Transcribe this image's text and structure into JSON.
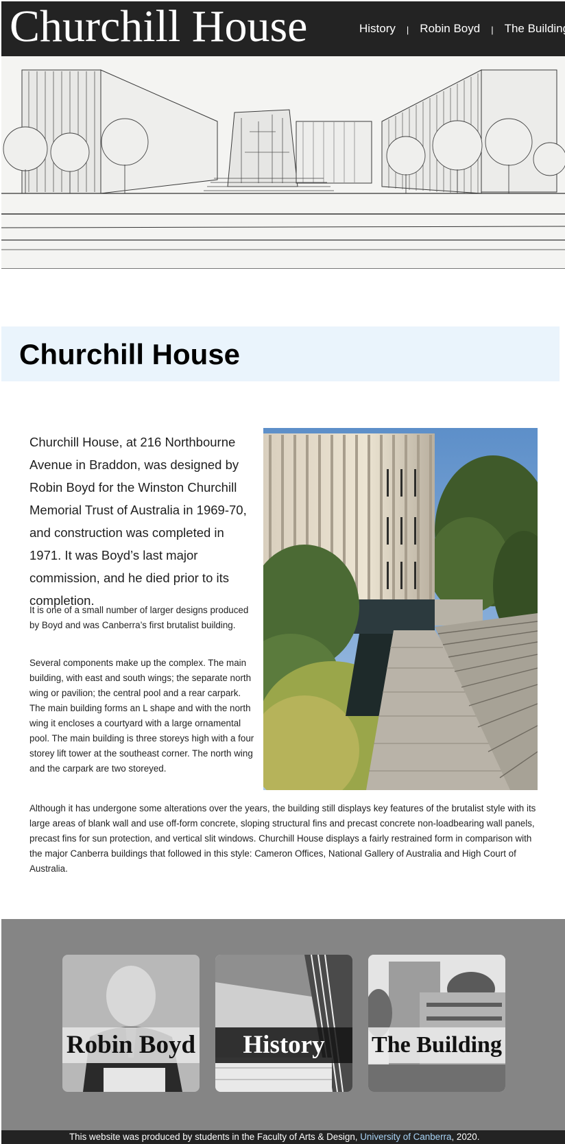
{
  "header": {
    "site_title": "Churchill House",
    "nav": [
      {
        "label": "History"
      },
      {
        "label": "Robin Boyd"
      },
      {
        "label": "The Building"
      }
    ],
    "separator": "|"
  },
  "main": {
    "page_title": "Churchill House",
    "lead": "Churchill House, at 216 Northbourne Avenue in Braddon, was designed by Robin Boyd for the Winston Churchill Memorial Trust of Australia in 1969-70, and construction was completed in 1971. It was Boyd’s last major commission, and he died prior to its completion.",
    "paragraphs": [
      "It is one of a small number of larger designs produced by Boyd and was Canberra’s first brutalist building.",
      "Several components make up the complex. The main building, with east and south wings; the separate north wing or pavilion; the central pool and a rear carpark. The main building forms an L shape and with the north wing it encloses a courtyard with a large ornamental pool. The main building is three storeys high with a four storey lift tower at the southeast corner. The north wing and the carpark are two storeyed.",
      "Although it has undergone some alterations over the years, the building still displays key features of the brutalist style with its large areas of blank wall and use off-form concrete, sloping structural fins and precast concrete non-loadbearing wall panels, precast fins for sun protection, and vertical slit windows. Churchill House displays a fairly restrained form in comparison with the major Canberra buildings that followed in this style: Cameron Offices, National Gallery of Australia and High Court of Australia."
    ]
  },
  "cards": [
    {
      "label": "Robin Boyd",
      "label_color": "#111111"
    },
    {
      "label": "History",
      "label_color": "#ffffff"
    },
    {
      "label": "The Building",
      "label_color": "#111111"
    }
  ],
  "footer": {
    "text_before": "This website was produced by students in the Faculty of Arts & Design, ",
    "link_text": "University of Canberra",
    "text_after": ", 2020."
  },
  "colors": {
    "header_bg": "#232323",
    "title_band_bg": "#eaf4fc",
    "cards_band_bg": "#858585",
    "footer_link": "#a9d4f7"
  }
}
